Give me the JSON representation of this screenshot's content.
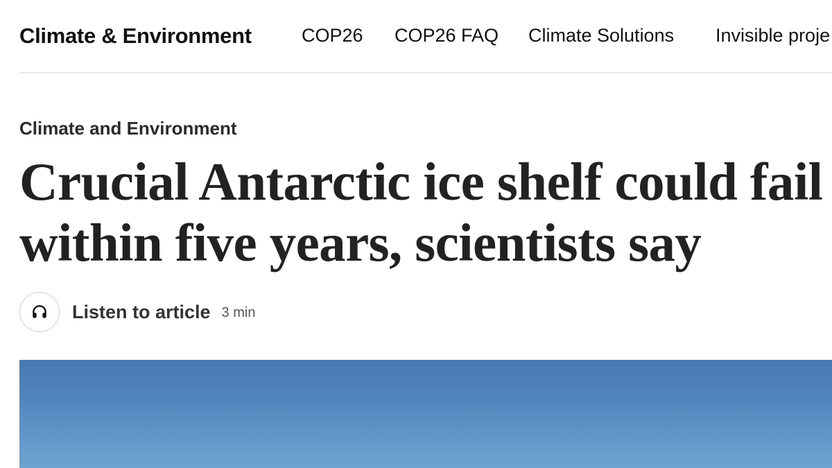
{
  "nav": {
    "brand": "Climate & Environment",
    "links": [
      {
        "label": "COP26"
      },
      {
        "label": "COP26 FAQ"
      },
      {
        "label": "Climate Solutions"
      },
      {
        "label": "Invisible proje"
      }
    ]
  },
  "article": {
    "kicker": "Climate and Environment",
    "headline": "Crucial Antarctic ice shelf could fail within five years, scientists say",
    "listen": {
      "label": "Listen to article",
      "duration": "3 min",
      "icon": "headphones-icon"
    },
    "hero_image": {
      "description_colors": [
        "#4a79b2",
        "#6ea4d0"
      ]
    }
  }
}
